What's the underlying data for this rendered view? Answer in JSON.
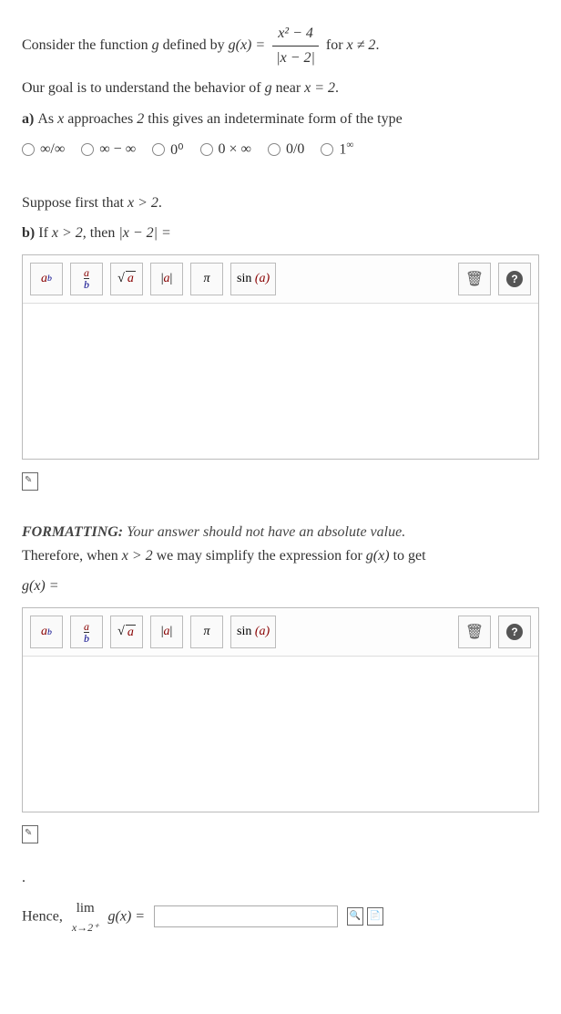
{
  "intro": {
    "t1": "Consider the function ",
    "g": "g",
    "t2": " defined by ",
    "gx": "g(x) = ",
    "num": "x² − 4",
    "den": "|x − 2|",
    "t3": " for ",
    "cond": "x ≠ 2",
    "dot": "."
  },
  "goal": {
    "t1": "Our goal is to understand the behavior of ",
    "g": "g",
    "t2": " near ",
    "eq": "x = 2",
    "dot": "."
  },
  "a": {
    "label": "a) ",
    "t1": "As ",
    "x": "x",
    "t2": " approaches ",
    "two": "2",
    "t3": " this gives an indeterminate form of the type"
  },
  "choices": [
    "∞/∞",
    "∞ − ∞",
    "0⁰",
    "0 × ∞",
    "0/0",
    "1^∞"
  ],
  "suppose": {
    "t1": "Suppose first that ",
    "cond": "x > 2",
    "dot": "."
  },
  "b": {
    "label": "b) ",
    "t1": "If ",
    "cond": "x > 2",
    "t2": ", then ",
    "expr": "|x − 2| ="
  },
  "toolbar": {
    "power": {
      "base": "a",
      "exp": "b"
    },
    "frac": {
      "a": "a",
      "b": "b"
    },
    "sqrt": {
      "sym": "√",
      "a": "a"
    },
    "abs": {
      "l": "|",
      "a": "a",
      "r": "|"
    },
    "pi": "π",
    "sin": {
      "fn": "sin",
      "a": "(a)"
    },
    "trash": "🗑",
    "help": "?"
  },
  "formatting": {
    "label": "FORMATTING:",
    "text": " Your answer should not have an absolute value."
  },
  "therefore": {
    "t1": "Therefore, when ",
    "cond": "x > 2",
    "t2": " we may simplify the expression for ",
    "gx": "g(x)",
    "t3": " to get"
  },
  "gxeq": "g(x) =",
  "dot_only": ".",
  "hence": {
    "t1": "Hence, ",
    "lim": "lim",
    "sub": "x→2⁺",
    "gx": "g(x) ="
  }
}
